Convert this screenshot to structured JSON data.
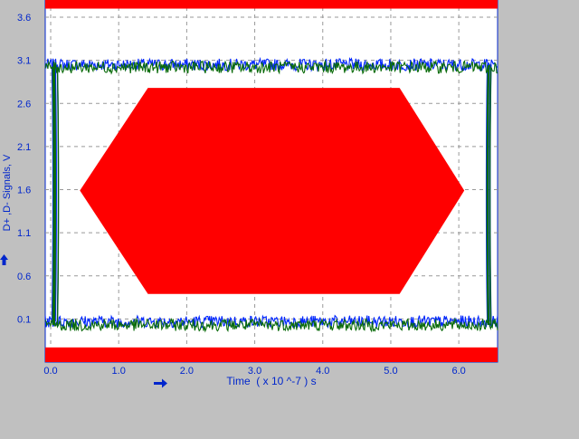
{
  "chart_data": {
    "type": "line",
    "xlabel": "Time  ( x 10 ^-7 ) s",
    "ylabel": "D+ ,D- Signals, V",
    "xlim": [
      -0.08,
      6.57
    ],
    "ylim": [
      -0.4,
      3.8
    ],
    "x_ticks": [
      0.0,
      1.0,
      2.0,
      3.0,
      4.0,
      5.0,
      6.0
    ],
    "x_tick_labels": [
      "0.0",
      "1.0",
      "2.0",
      "3.0",
      "4.0",
      "5.0",
      "6.0"
    ],
    "y_ticks": [
      3.6,
      3.1,
      2.6,
      2.1,
      1.6,
      1.1,
      0.6,
      0.1
    ],
    "y_tick_labels": [
      "3.6",
      "3.1",
      "2.6",
      "2.1",
      "1.6",
      "1.1",
      "0.6",
      "0.1"
    ],
    "grid": true,
    "series": [
      {
        "color": "#0026ff",
        "high_level": 3.05,
        "low_level": 0.07,
        "transitions": [
          0.03,
          6.49
        ]
      },
      {
        "color": "#0a6b0a",
        "high_level": 3.02,
        "low_level": 0.03,
        "transitions": [
          0.04,
          6.47
        ]
      }
    ],
    "eye_mask": {
      "color": "#ff0000",
      "polygon": [
        [
          0.43,
          1.59
        ],
        [
          1.43,
          2.78
        ],
        [
          5.13,
          2.78
        ],
        [
          6.08,
          1.59
        ],
        [
          5.13,
          0.39
        ],
        [
          1.43,
          0.39
        ]
      ]
    },
    "limit_bands": [
      {
        "color": "#ff0000",
        "y_from": 3.7,
        "y_to": 3.8
      },
      {
        "color": "#ff0000",
        "y_from": -0.4,
        "y_to": -0.23
      }
    ]
  },
  "colors": {
    "background": "#c0c0c0",
    "plot_background": "#ffffff",
    "axis_text": "#0026cc",
    "grid": "#999999"
  },
  "icons": [
    "x-axis-arrow-icon",
    "y-axis-arrow-icon"
  ]
}
